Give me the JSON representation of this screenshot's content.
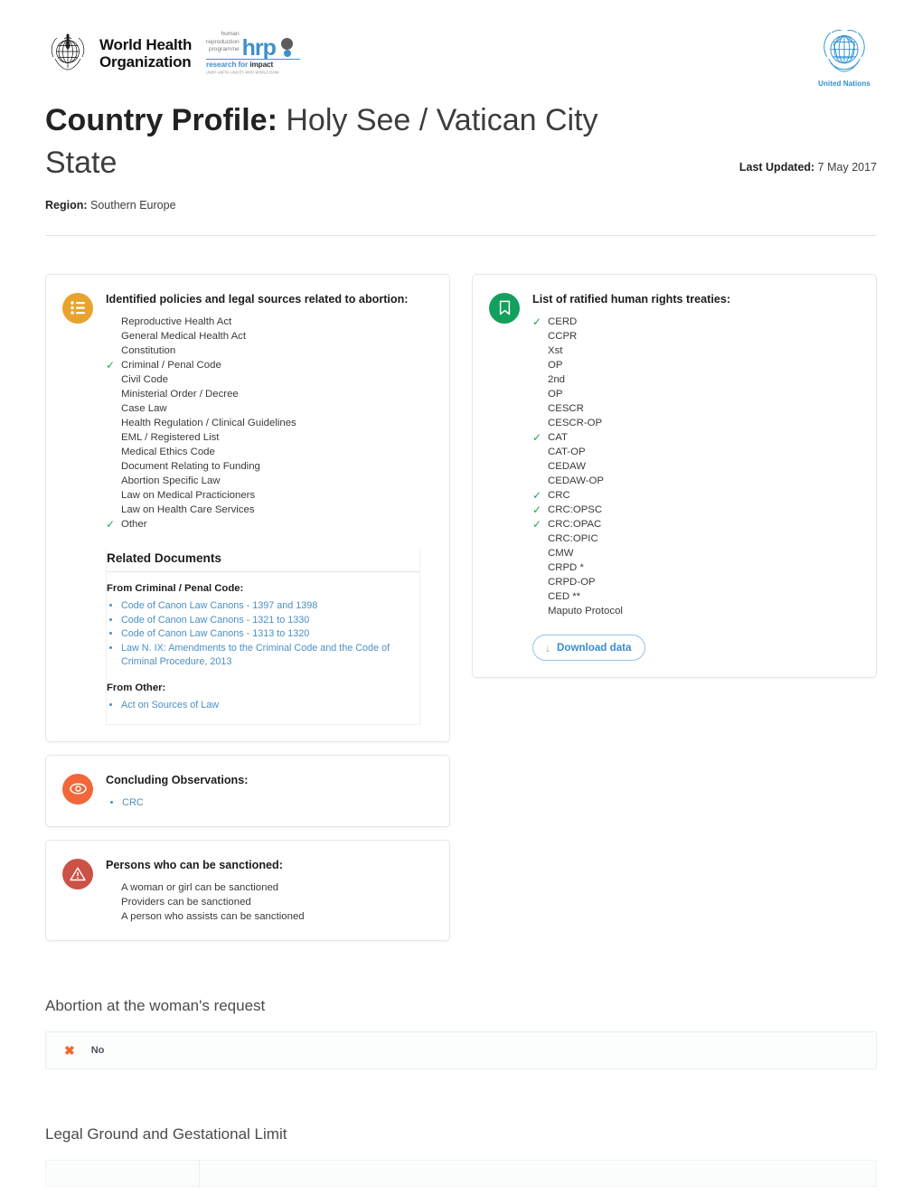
{
  "header": {
    "who_line1": "World Health",
    "who_line2": "Organization",
    "who_alt": "who-logo",
    "hrp_word1": "human",
    "hrp_word2": "reproduction",
    "hrp_word3": "programme",
    "hrp_mark": "hrp",
    "hrp_tagline_a": "research for ",
    "hrp_tagline_b": "impact",
    "hrp_fineprint": "UNDP·UNFPA·UNICEF·WHO·WORLD BANK",
    "un_label": "United Nations"
  },
  "title": {
    "prefix": "Country Profile:",
    "country": " Holy See / Vatican City State",
    "last_updated_label": "Last Updated:",
    "last_updated_value": " 7 May 2017",
    "region_label": "Region:",
    "region_value": " Southern Europe"
  },
  "policies_card": {
    "icon": "list-icon",
    "icon_color": "#e8a32e",
    "heading": "Identified policies and legal sources related to abortion:",
    "items": [
      {
        "label": "Reproductive Health Act",
        "checked": false
      },
      {
        "label": "General Medical Health Act",
        "checked": false
      },
      {
        "label": "Constitution",
        "checked": false
      },
      {
        "label": "Criminal / Penal Code",
        "checked": true
      },
      {
        "label": "Civil Code",
        "checked": false
      },
      {
        "label": "Ministerial Order / Decree",
        "checked": false
      },
      {
        "label": "Case Law",
        "checked": false
      },
      {
        "label": "Health Regulation / Clinical Guidelines",
        "checked": false
      },
      {
        "label": "EML / Registered List",
        "checked": false
      },
      {
        "label": "Medical Ethics Code",
        "checked": false
      },
      {
        "label": "Document Relating to Funding",
        "checked": false
      },
      {
        "label": "Abortion Specific Law",
        "checked": false
      },
      {
        "label": "Law on Medical Practicioners",
        "checked": false
      },
      {
        "label": "Law on Health Care Services",
        "checked": false
      },
      {
        "label": "Other",
        "checked": true
      }
    ]
  },
  "related_documents": {
    "title": "Related Documents",
    "groups": [
      {
        "label": "From Criminal / Penal Code:",
        "links": [
          "Code of Canon Law Canons - 1397 and 1398",
          "Code of Canon Law Canons - 1321 to 1330",
          "Code of Canon Law Canons - 1313 to 1320",
          "Law N. IX: Amendments to the Criminal Code and the Code of Criminal Procedure, 2013"
        ]
      },
      {
        "label": "From Other:",
        "links": [
          "Act on Sources of Law"
        ]
      }
    ]
  },
  "treaties_card": {
    "icon": "bookmark-icon",
    "icon_color": "#12a05c",
    "heading": "List of ratified human rights treaties:",
    "items": [
      {
        "label": "CERD",
        "checked": true
      },
      {
        "label": "CCPR",
        "checked": false
      },
      {
        "label": "Xst",
        "checked": false
      },
      {
        "label": "OP",
        "checked": false
      },
      {
        "label": "2nd",
        "checked": false
      },
      {
        "label": "OP",
        "checked": false
      },
      {
        "label": "CESCR",
        "checked": false
      },
      {
        "label": "CESCR-OP",
        "checked": false
      },
      {
        "label": "CAT",
        "checked": true
      },
      {
        "label": "CAT-OP",
        "checked": false
      },
      {
        "label": "CEDAW",
        "checked": false
      },
      {
        "label": "CEDAW-OP",
        "checked": false
      },
      {
        "label": "CRC",
        "checked": true
      },
      {
        "label": "CRC:OPSC",
        "checked": true
      },
      {
        "label": "CRC:OPAC",
        "checked": true
      },
      {
        "label": "CRC:OPIC",
        "checked": false
      },
      {
        "label": "CMW",
        "checked": false
      },
      {
        "label": "CRPD *",
        "checked": false
      },
      {
        "label": "CRPD-OP",
        "checked": false
      },
      {
        "label": "CED **",
        "checked": false
      },
      {
        "label": "Maputo Protocol",
        "checked": false
      }
    ],
    "download_label": "Download data",
    "download_icon": "download-arrow-icon"
  },
  "observations_card": {
    "icon": "eye-icon",
    "icon_color": "#f26739",
    "heading": "Concluding Observations:",
    "links": [
      "CRC"
    ]
  },
  "sanctions_card": {
    "icon": "warning-icon",
    "icon_color": "#cc5146",
    "heading": "Persons who can be sanctioned:",
    "items": [
      "A woman or girl can be sanctioned",
      "Providers can be sanctioned",
      "A person who assists can be sanctioned"
    ]
  },
  "request_section": {
    "title": "Abortion at the woman's request",
    "answer_icon": "x-mark-icon",
    "answer": "No"
  },
  "ground_section": {
    "title": "Legal Ground and Gestational Limit"
  }
}
